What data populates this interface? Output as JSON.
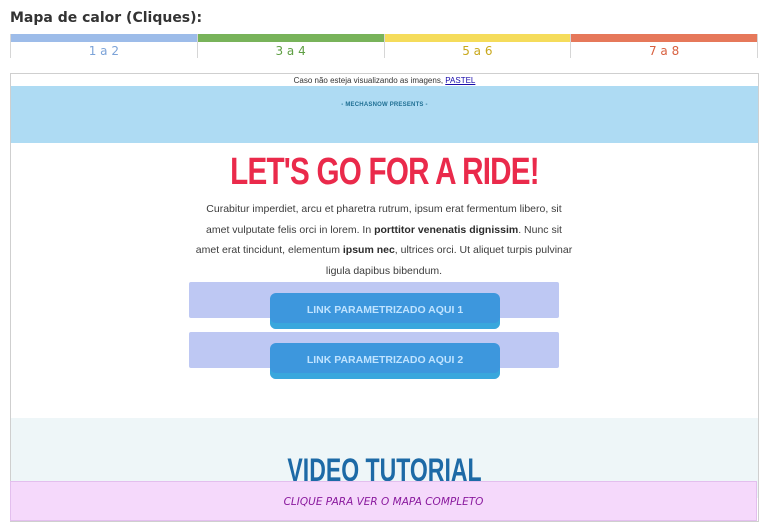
{
  "heatmap": {
    "title": "Mapa de calor (Cliques):",
    "legend": [
      {
        "label": "1 a 2",
        "color": "#9dbce9",
        "text_color": "#7ca3d8"
      },
      {
        "label": "3 a 4",
        "color": "#78b35a",
        "text_color": "#5f9f44"
      },
      {
        "label": "5 a 6",
        "color": "#f5dc5b",
        "text_color": "#c9a81c"
      },
      {
        "label": "7 a 8",
        "color": "#e6785a",
        "text_color": "#d8603f"
      }
    ]
  },
  "email": {
    "notice_text": "Caso não esteja visualizando as imagens,",
    "notice_link": "PASTEL",
    "presents": "- MECHASNOW PRESENTS -",
    "headline": "LET'S GO FOR A RIDE!",
    "body": {
      "p1": "Curabitur imperdiet, arcu et pharetra rutrum, ipsum erat fermentum libero, sit amet vulputate felis orci in lorem. In ",
      "b1": "porttitor venenatis dignissim",
      "p2": ". Nunc sit amet erat tincidunt, elementum ",
      "b2": "ipsum nec",
      "p3": ", ultrices orci. Ut aliquet turpis pulvinar ligula dapibus bibendum."
    },
    "buttons": [
      {
        "label": "LINK PARAMETRIZADO AQUI 1"
      },
      {
        "label": "LINK PARAMETRIZADO AQUI 2"
      }
    ],
    "video_title": "VIDEO TUTORIAL"
  },
  "footer": {
    "full_map_label": "CLIQUE PARA VER O MAPA COMPLETO"
  }
}
